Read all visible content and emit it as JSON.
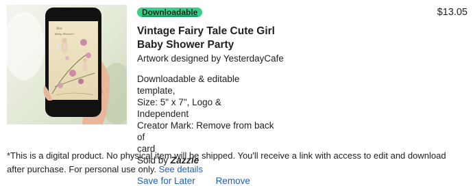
{
  "product": {
    "image_alt": "Phone showing vintage fairy tale baby shower invitation",
    "badge": "Downloadable",
    "title": "Vintage Fairy Tale Cute Girl Baby Shower Party",
    "designer": "Artwork designed by YesterdayCafe",
    "specs": [
      "Downloadable & editable template,",
      "Size: 5\" x 7\", Logo & Independent",
      "Creator Mark: Remove from back of",
      "card"
    ],
    "sold_by_prefix": "Sold by ",
    "sold_by_brand": "Zazzle",
    "price": "$13.05"
  },
  "actions": {
    "save_label": "Save for Later",
    "remove_label": "Remove"
  },
  "notice": {
    "text": "*This is a digital product. No physical item will be shipped. You'll receive a link with access to edit and download after purchase. For personal use only.",
    "link": "See details"
  },
  "colors": {
    "badge_bg": "#35d08a",
    "link": "#1f5fbf"
  }
}
